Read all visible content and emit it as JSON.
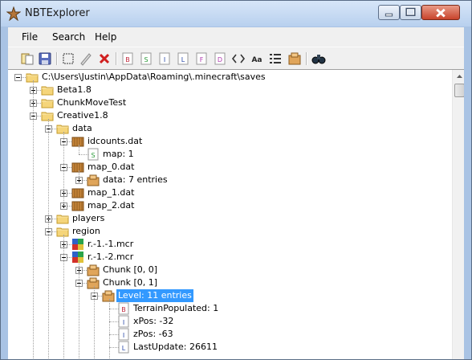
{
  "window": {
    "title": "NBTExplorer",
    "icons": {
      "app": "nbt-star-icon",
      "minimize": "minimize-icon",
      "maximize": "maximize-icon",
      "close": "close-icon"
    }
  },
  "menu": {
    "items": [
      "File",
      "Search",
      "Help"
    ]
  },
  "toolbar": {
    "buttons": [
      "open-folder-icon",
      "save-icon",
      "select-icon",
      "rename-icon",
      "delete-icon",
      "add-byte-tag-icon",
      "add-short-tag-icon",
      "add-int-tag-icon",
      "add-long-tag-icon",
      "add-float-tag-icon",
      "add-double-tag-icon",
      "add-byte-array-icon",
      "add-string-tag-icon",
      "add-list-tag-icon",
      "add-compound-tag-icon",
      "find-icon"
    ]
  },
  "tree": {
    "nodes": [
      {
        "label": "C:\\Users\\Justin\\AppData\\Roaming\\.minecraft\\saves",
        "icon": "folder-icon",
        "expander": "minus",
        "level": 0
      },
      {
        "label": "Beta1.8",
        "icon": "folder-icon",
        "expander": "plus",
        "level": 1
      },
      {
        "label": "ChunkMoveTest",
        "icon": "folder-icon",
        "expander": "plus",
        "level": 1
      },
      {
        "label": "Creative1.8",
        "icon": "folder-icon",
        "expander": "minus",
        "level": 1
      },
      {
        "label": "data",
        "icon": "folder-icon",
        "expander": "minus",
        "level": 2
      },
      {
        "label": "idcounts.dat",
        "icon": "dat-file-icon",
        "expander": "minus",
        "level": 3
      },
      {
        "label": "map: 1",
        "icon": "short-tag-icon",
        "expander": "none",
        "level": 4
      },
      {
        "label": "map_0.dat",
        "icon": "dat-file-icon",
        "expander": "minus",
        "level": 3
      },
      {
        "label": "data: 7 entries",
        "icon": "compound-tag-icon",
        "expander": "plus",
        "level": 4
      },
      {
        "label": "map_1.dat",
        "icon": "dat-file-icon",
        "expander": "plus",
        "level": 3
      },
      {
        "label": "map_2.dat",
        "icon": "dat-file-icon",
        "expander": "plus",
        "level": 3
      },
      {
        "label": "players",
        "icon": "folder-icon",
        "expander": "plus",
        "level": 2
      },
      {
        "label": "region",
        "icon": "folder-icon",
        "expander": "minus",
        "level": 2
      },
      {
        "label": "r.-1.-1.mcr",
        "icon": "region-file-icon",
        "expander": "plus",
        "level": 3
      },
      {
        "label": "r.-1.-2.mcr",
        "icon": "region-file-icon",
        "expander": "minus",
        "level": 3
      },
      {
        "label": "Chunk [0, 0]",
        "icon": "chunk-icon",
        "expander": "plus",
        "level": 4
      },
      {
        "label": "Chunk [0, 1]",
        "icon": "chunk-icon",
        "expander": "minus",
        "level": 4
      },
      {
        "label": "Level: 11 entries",
        "icon": "compound-tag-icon",
        "expander": "minus",
        "level": 5,
        "selected": true
      },
      {
        "label": "TerrainPopulated: 1",
        "icon": "byte-tag-icon",
        "expander": "none",
        "level": 6
      },
      {
        "label": "xPos: -32",
        "icon": "int-tag-icon",
        "expander": "none",
        "level": 6
      },
      {
        "label": "zPos: -63",
        "icon": "int-tag-icon",
        "expander": "none",
        "level": 6
      },
      {
        "label": "LastUpdate: 26611",
        "icon": "long-tag-icon",
        "expander": "none",
        "level": 6
      }
    ]
  },
  "scrollbar": {
    "up": "scroll-up-arrow-icon",
    "down": "scroll-down-arrow-icon"
  }
}
